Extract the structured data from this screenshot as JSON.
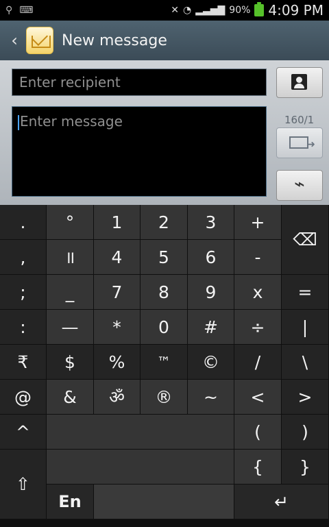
{
  "status_bar": {
    "battery": "90%",
    "time": "4:09 PM"
  },
  "title": "New message",
  "compose": {
    "recipient_placeholder": "Enter recipient",
    "message_placeholder": "Enter message",
    "counter": "160/1"
  },
  "keyboard": {
    "rows": [
      [
        ".",
        "°",
        "1",
        "2",
        "3",
        "+",
        "⌫"
      ],
      [
        ",",
        "॥",
        "4",
        "5",
        "6",
        "-",
        ""
      ],
      [
        ";",
        "_",
        "7",
        "8",
        "9",
        "x",
        "="
      ],
      [
        ":",
        "—",
        "*",
        "0",
        "#",
        "÷",
        "|"
      ],
      [
        "₹",
        "$",
        "%",
        "™",
        "©",
        "/",
        "\\"
      ],
      [
        "@",
        "&",
        "ॐ",
        "®",
        "~",
        "<",
        ">"
      ],
      [
        "^",
        "",
        "",
        "",
        "",
        "(",
        ")"
      ],
      [
        "",
        "",
        "",
        "",
        "",
        "{",
        "}"
      ]
    ],
    "shift": "⇧",
    "lang": "En",
    "enter": "↵"
  },
  "colors": {
    "accent": "#4aa3ff",
    "battery": "#56c12a"
  }
}
